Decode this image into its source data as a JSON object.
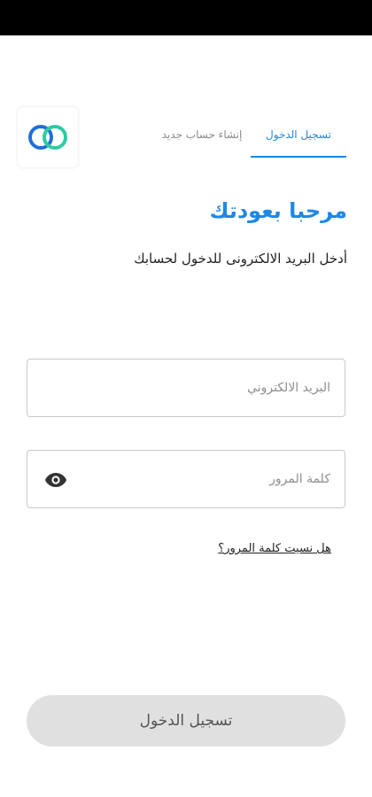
{
  "tabs": {
    "login_label": "تسجيل الدخول",
    "register_label": "إنشاء حساب جديد"
  },
  "welcome": {
    "title": "مرحبا بعودتك",
    "subtitle": "أدخل البريد الالكترونى للدخول لحسابك"
  },
  "form": {
    "email_placeholder": "البريد الالكتروني",
    "email_value": "",
    "password_placeholder": "كلمة المرور",
    "password_value": "",
    "forgot_password": "هل نسيت كلمة المرور؟",
    "submit_label": "تسجيل الدخول"
  },
  "icons": {
    "logo": "interlocking-rings-logo",
    "password_toggle": "eye-icon"
  },
  "colors": {
    "accent": "#1E88E5",
    "logo_blue": "#1E6FD9",
    "logo_green": "#2ECBA4",
    "button_disabled": "#e0e0e0"
  }
}
